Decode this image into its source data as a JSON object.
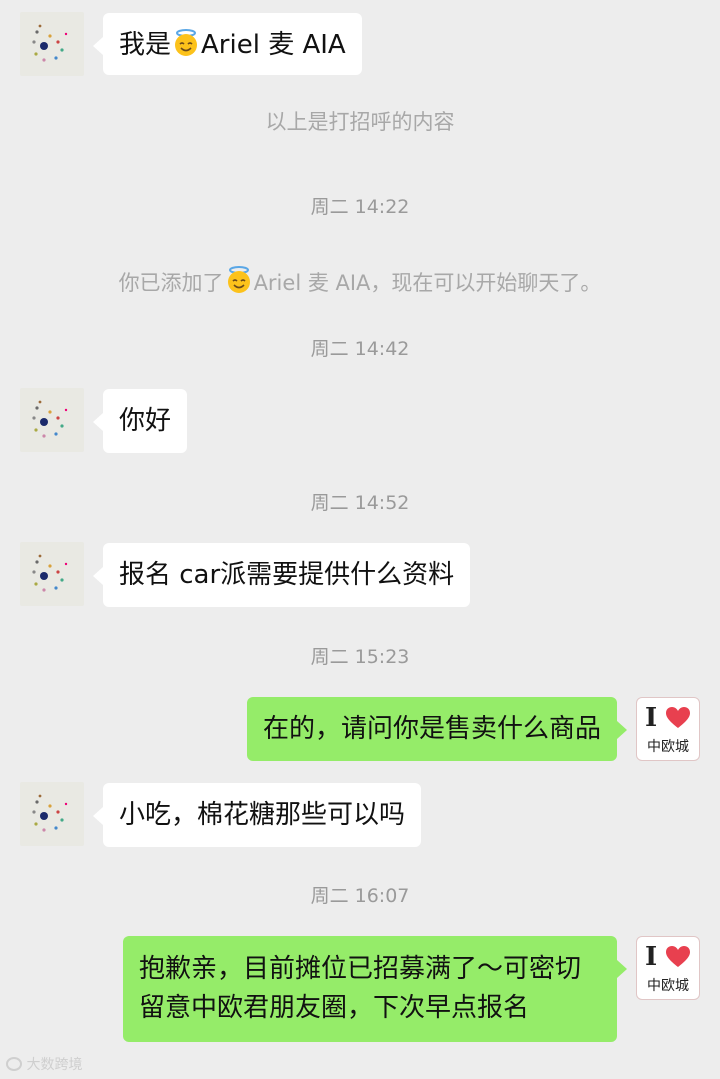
{
  "messages": {
    "m1": "我是",
    "m1_name": "Ariel 麦 AIA",
    "sys1": "以上是打招呼的内容",
    "t1": "周二 14:22",
    "sys2_a": "你已添加了",
    "sys2_b": "Ariel 麦 AIA，现在可以开始聊天了。",
    "t2": "周二 14:42",
    "m2": "你好",
    "t3": "周二 14:52",
    "m3": "报名 car派需要提供什么资料",
    "t4": "周二 15:23",
    "m4": "在的，请问你是售卖什么商品",
    "m5": "小吃，棉花糖那些可以吗",
    "t5": "周二 16:07",
    "m6_line1": "抱歉亲，目前摊位已招募满了～可密切",
    "m6_line2": "留意中欧君朋友圈，下次早点报名"
  },
  "brand_avatar": {
    "letter": "I",
    "subtitle": "中欧城"
  },
  "watermark": "大数跨境",
  "colors": {
    "background": "#ededed",
    "outgoing_bubble": "#95ec69",
    "incoming_bubble": "#ffffff",
    "timestamp": "#9a9a9a",
    "heart": "#e8404f"
  },
  "icons": {
    "emoji": "smiling-face-with-halo-icon",
    "heart": "heart-icon"
  }
}
